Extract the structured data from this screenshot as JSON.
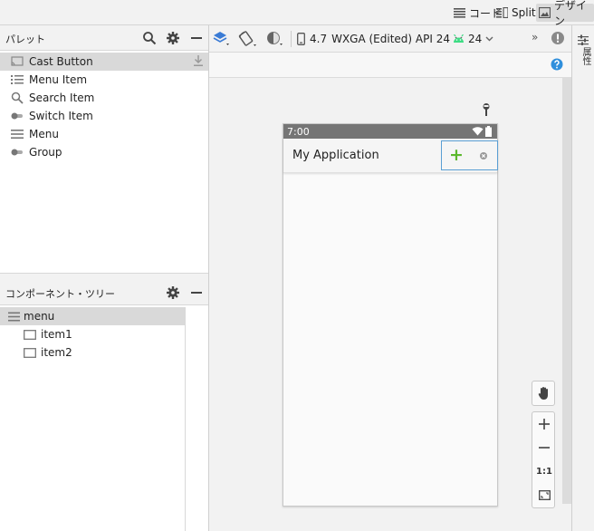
{
  "modes": {
    "code_label": "コード",
    "split_label": "Split",
    "design_label": "デザイン"
  },
  "palette": {
    "title": "パレット",
    "items": [
      {
        "label": "Cast Button",
        "icon": "cast-icon"
      },
      {
        "label": "Menu Item",
        "icon": "list-icon"
      },
      {
        "label": "Search Item",
        "icon": "search-icon"
      },
      {
        "label": "Switch Item",
        "icon": "toggle-icon"
      },
      {
        "label": "Menu",
        "icon": "hamburger-icon"
      },
      {
        "label": "Group",
        "icon": "toggle-icon"
      }
    ]
  },
  "tree": {
    "title": "コンポーネント・ツリー",
    "root": "menu",
    "children": [
      "item1",
      "item2"
    ]
  },
  "toolbar": {
    "device_size": "4.7",
    "device_name": "WXGA (Edited) API 24",
    "api_level": "24",
    "overflow": "»"
  },
  "right_strip": {
    "label": "属性"
  },
  "phone": {
    "time": "7:00",
    "app_title": "My Application",
    "add_symbol": "+"
  },
  "zoom": {
    "one_to_one": "1:1"
  },
  "colors": {
    "accent_blue": "#3a7bd5",
    "android_green": "#3ddc84",
    "plus_green": "#5bb82c",
    "status_bar": "#757575"
  }
}
